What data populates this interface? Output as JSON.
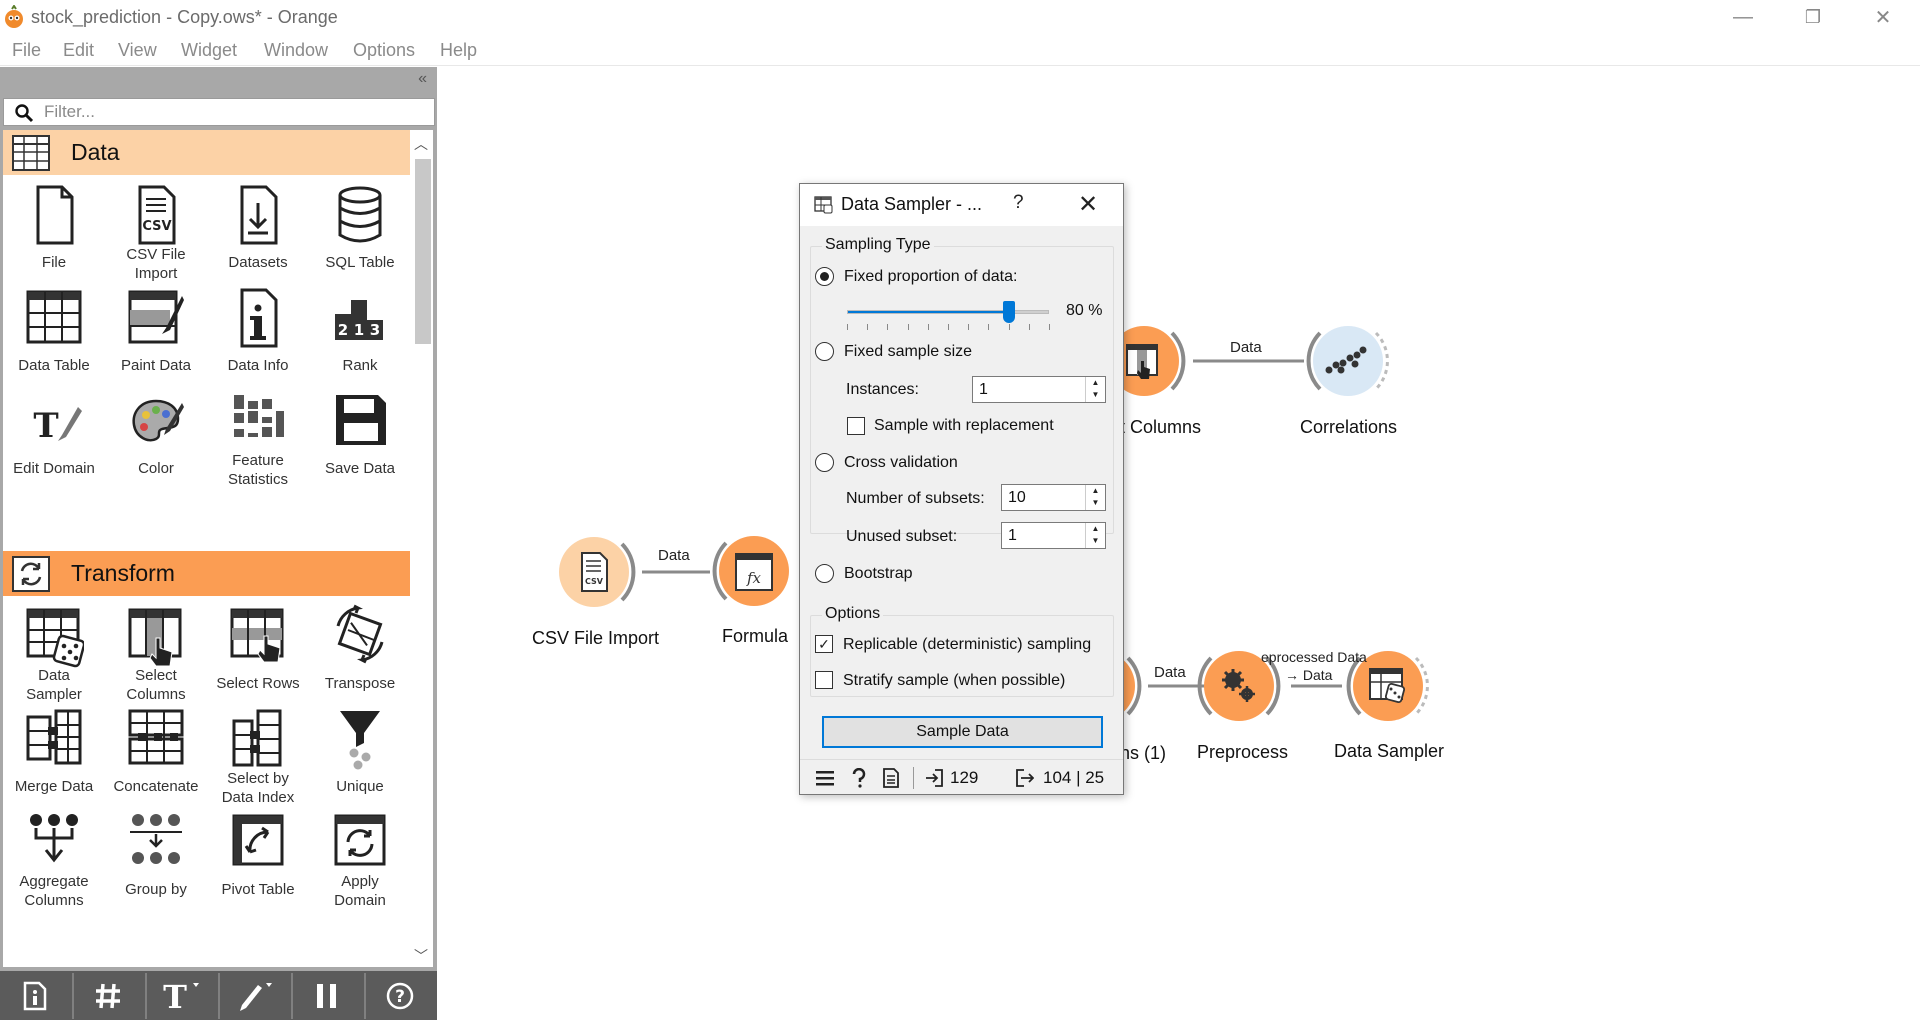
{
  "window": {
    "title": "stock_prediction - Copy.ows* - Orange",
    "controls": {
      "minimize": "—",
      "restore": "❐",
      "close": "✕"
    }
  },
  "menu": [
    "File",
    "Edit",
    "View",
    "Widget",
    "Window",
    "Options",
    "Help"
  ],
  "sidebar": {
    "collapse_glyph": "«",
    "filter_placeholder": "Filter...",
    "categories": [
      {
        "name": "Data",
        "color": "#fcd2a6",
        "widgets": [
          "File",
          "CSV File\nImport",
          "Datasets",
          "SQL Table",
          "Data Table",
          "Paint Data",
          "Data Info",
          "Rank",
          "Edit Domain",
          "Color",
          "Feature\nStatistics",
          "Save Data"
        ]
      },
      {
        "name": "Transform",
        "color": "#fb9d53",
        "widgets": [
          "Data\nSampler",
          "Select\nColumns",
          "Select Rows",
          "Transpose",
          "Merge Data",
          "Concatenate",
          "Select by\nData Index",
          "Unique",
          "Aggregate\nColumns",
          "Group by",
          "Pivot Table",
          "Apply\nDomain"
        ]
      }
    ],
    "bottom_toolbar": [
      "info-icon",
      "grid-icon",
      "text-icon",
      "pen-icon",
      "pause-icon",
      "help-icon"
    ]
  },
  "canvas": {
    "nodes": [
      {
        "id": "csv",
        "label": "CSV File Import"
      },
      {
        "id": "formula",
        "label": "Formula"
      },
      {
        "id": "select-columns",
        "label": "t Columns"
      },
      {
        "id": "correlations",
        "label": "Correlations"
      },
      {
        "id": "select-columns-1",
        "label": "ns (1)"
      },
      {
        "id": "preprocess",
        "label": "Preprocess"
      },
      {
        "id": "data-sampler",
        "label": "Data Sampler"
      }
    ],
    "links": {
      "csv_formula": "Data",
      "select_correlations": "Data",
      "sc1_preprocess": "Data",
      "preprocess_sampler_top": "eprocessed Data",
      "preprocess_sampler_bottom": "→ Data"
    }
  },
  "dialog": {
    "title": "Data Sampler - ...",
    "help": "?",
    "close": "✕",
    "sampling_type": {
      "title": "Sampling Type",
      "fixed_proportion": {
        "label": "Fixed proportion of data:",
        "selected": true,
        "value_pct": 80,
        "value_text": "80 %"
      },
      "fixed_sample_size": {
        "label": "Fixed sample size",
        "selected": false
      },
      "instances": {
        "label": "Instances:",
        "value": "1"
      },
      "replacement": {
        "label": "Sample with replacement",
        "checked": false
      },
      "cross_validation": {
        "label": "Cross validation",
        "selected": false
      },
      "subsets": {
        "label": "Number of subsets:",
        "value": "10"
      },
      "unused": {
        "label": "Unused subset:",
        "value": "1"
      },
      "bootstrap": {
        "label": "Bootstrap",
        "selected": false
      }
    },
    "options": {
      "title": "Options",
      "replicable": {
        "label": "Replicable (deterministic) sampling",
        "checked": true
      },
      "stratify": {
        "label": "Stratify sample (when possible)",
        "checked": false
      }
    },
    "button": "Sample Data",
    "status": {
      "input": "129",
      "output": "104 | 25"
    }
  }
}
